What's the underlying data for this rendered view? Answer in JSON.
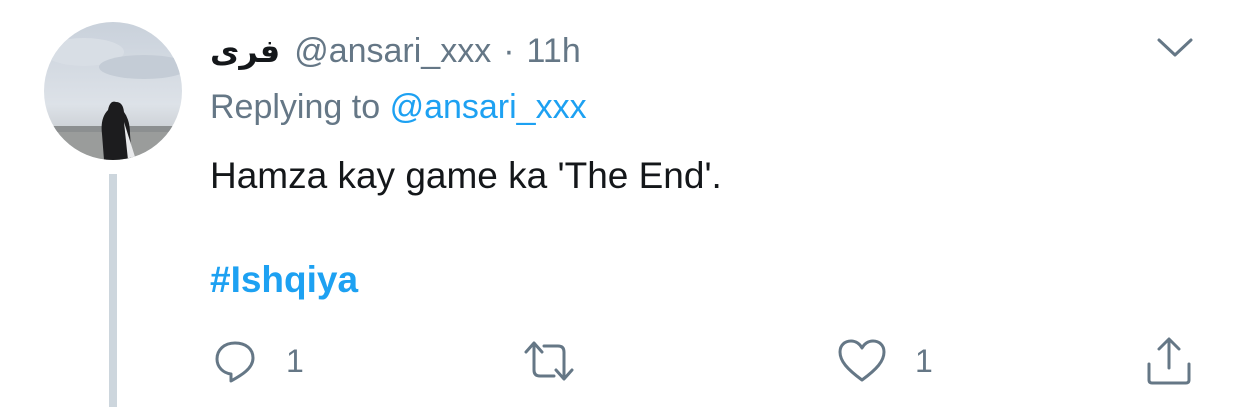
{
  "tweet": {
    "display_name": "فری",
    "handle": "@ansari_xxx",
    "separator": "·",
    "time": "11h",
    "replying_prefix": "Replying to",
    "replying_handle": "@ansari_xxx",
    "text": "Hamza kay game ka 'The End'.",
    "hashtag": "#Ishqiya"
  },
  "actions": {
    "reply": {
      "icon": "reply-icon",
      "count": "1"
    },
    "retweet": {
      "icon": "retweet-icon",
      "count": ""
    },
    "like": {
      "icon": "heart-icon",
      "count": "1"
    },
    "share": {
      "icon": "share-icon"
    }
  },
  "colors": {
    "text_primary": "#14171a",
    "text_secondary": "#657786",
    "link": "#1da1f2",
    "thread_line": "#cdd6dd"
  }
}
